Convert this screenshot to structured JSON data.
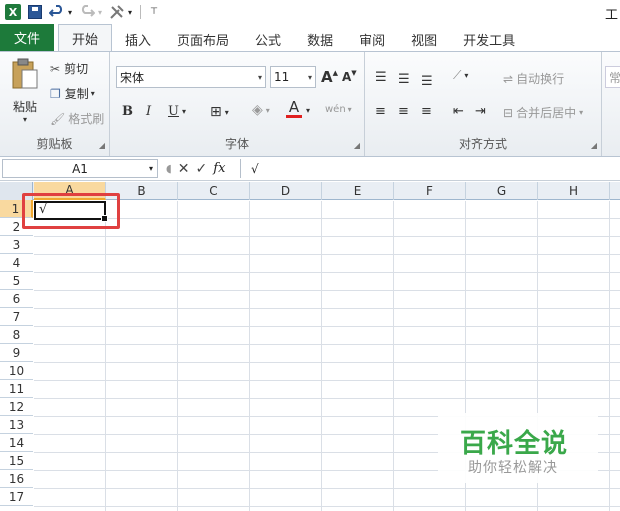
{
  "window": {
    "title_fragment": "工"
  },
  "tabs": [
    {
      "label": "文件",
      "kind": "file"
    },
    {
      "label": "开始",
      "kind": "active"
    },
    {
      "label": "插入"
    },
    {
      "label": "页面布局"
    },
    {
      "label": "公式"
    },
    {
      "label": "数据"
    },
    {
      "label": "审阅"
    },
    {
      "label": "视图"
    },
    {
      "label": "开发工具"
    }
  ],
  "clipboard": {
    "paste": "粘贴",
    "cut": "剪切",
    "copy": "复制",
    "format_painter": "格式刷",
    "group_label": "剪贴板"
  },
  "font": {
    "name": "宋体",
    "size": "11",
    "grow": "A",
    "shrink": "A",
    "bold": "B",
    "italic": "I",
    "underline": "U",
    "font_color_glyph": "A",
    "phonetic_glyph": "wén",
    "group_label": "字体"
  },
  "alignment": {
    "wrap_text": "自动换行",
    "merge_center": "合并后居中",
    "group_label": "对齐方式",
    "number_partial": "常"
  },
  "formula_bar": {
    "name_box": "A1",
    "fx": "fx",
    "content": "√"
  },
  "grid": {
    "columns": [
      "A",
      "B",
      "C",
      "D",
      "E",
      "F",
      "G",
      "H"
    ],
    "rows": [
      "1",
      "2",
      "3",
      "4",
      "5",
      "6",
      "7",
      "8",
      "9",
      "10",
      "11",
      "12",
      "13",
      "14",
      "15",
      "16",
      "17"
    ],
    "active_cell_value": "√"
  },
  "watermark": {
    "title": "百科全说",
    "subtitle": "助你轻松解决"
  },
  "colors": {
    "file_tab": "#1d7a3a",
    "highlight": "#e04040",
    "header_selected": "#f9d99f",
    "watermark_green": "#3aa84a"
  }
}
